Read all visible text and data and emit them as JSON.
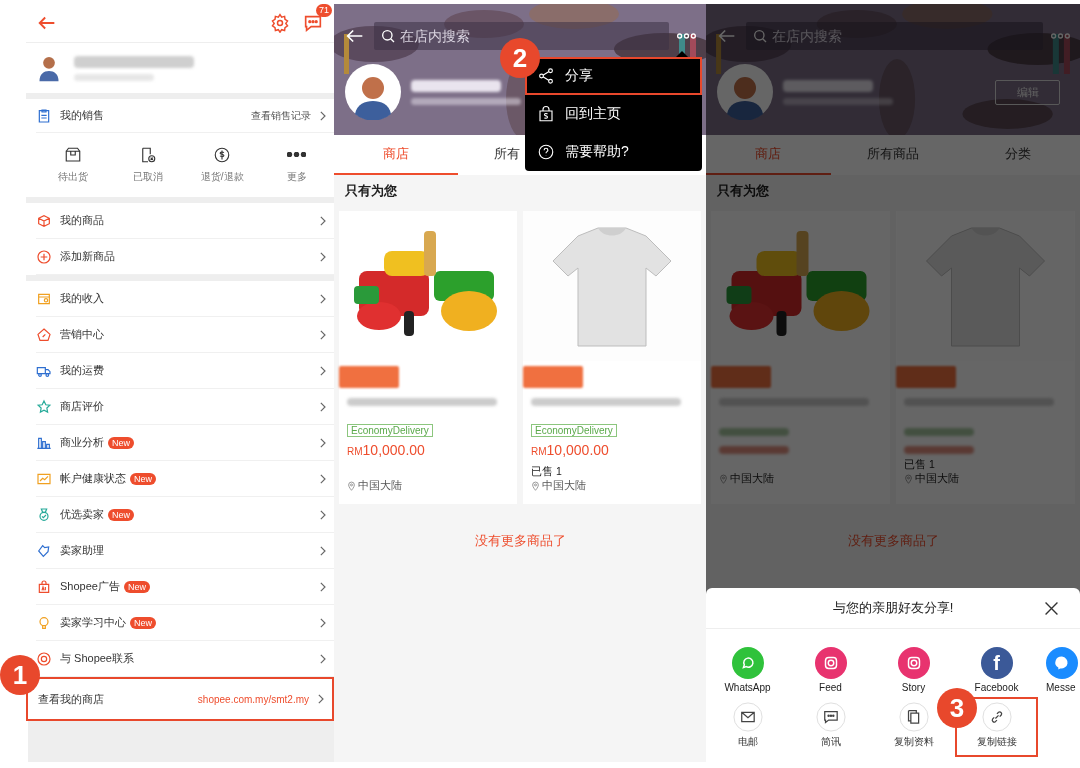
{
  "seller_center": {
    "chat_badge": "71",
    "sales": {
      "title": "我的销售",
      "link": "查看销售记录"
    },
    "shortcuts": [
      {
        "label": "待出货"
      },
      {
        "label": "已取消"
      },
      {
        "label": "退货/退款"
      },
      {
        "label": "更多"
      }
    ],
    "groups": [
      [
        {
          "label": "我的商品"
        },
        {
          "label": "添加新商品"
        }
      ],
      [
        {
          "label": "我的收入"
        },
        {
          "label": "营销中心"
        },
        {
          "label": "我的运费"
        },
        {
          "label": "商店评价"
        },
        {
          "label": "商业分析",
          "badge": "New"
        },
        {
          "label": "帐户健康状态",
          "badge": "New"
        },
        {
          "label": "优选卖家",
          "badge": "New"
        },
        {
          "label": "卖家助理"
        },
        {
          "label": "Shopee广告",
          "badge": "New"
        },
        {
          "label": "卖家学习中心",
          "badge": "New"
        },
        {
          "label": "与 Shopee联系"
        }
      ]
    ],
    "shop_link": {
      "label": "查看我的商店",
      "url": "shopee.com.my/smt2.my",
      "highlighted": true
    }
  },
  "shop_screens": [
    {
      "search_placeholder": "在店内搜索",
      "tabs": [
        {
          "label": "商店",
          "selected": true
        },
        {
          "label": "所有",
          "selected": false
        }
      ],
      "section_title": "只有为您",
      "products": [
        {
          "tag": "EconomyDelivery",
          "currency": "RM",
          "price": "10,000.00",
          "location": "中国大陆"
        },
        {
          "tag": "EconomyDelivery",
          "currency": "RM",
          "price": "10,000.00",
          "sold": "已售 1",
          "location": "中国大陆"
        }
      ],
      "end_note": "没有更多商品了",
      "menu": [
        {
          "label": "分享",
          "highlighted": true
        },
        {
          "label": "回到主页",
          "highlighted": false
        },
        {
          "label": "需要帮助?",
          "highlighted": false
        }
      ]
    },
    {
      "search_placeholder": "在店内搜索",
      "edit_button": "编辑",
      "tabs": [
        {
          "label": "商店",
          "selected": true
        },
        {
          "label": "所有商品",
          "selected": false
        },
        {
          "label": "分类",
          "selected": false
        }
      ],
      "section_title": "只有为您",
      "products": [
        {
          "location": "中国大陆"
        },
        {
          "sold": "已售 1",
          "location": "中国大陆"
        }
      ],
      "end_note": "没有更多商品了",
      "share_sheet": {
        "title": "与您的亲朋好友分享!",
        "apps": [
          {
            "label": "WhatsApp",
            "kind": "whatsapp",
            "color": "#2fc23b"
          },
          {
            "label": "Feed",
            "kind": "instagram",
            "color": "#e8336f"
          },
          {
            "label": "Story",
            "kind": "instagram",
            "color": "#e8336f"
          },
          {
            "label": "Facebook",
            "kind": "facebook",
            "glyph": "f",
            "color": "#3b5998"
          },
          {
            "label": "Messe",
            "kind": "messenger",
            "color": "#1a8cff"
          }
        ],
        "actions": [
          {
            "label": "电邮",
            "kind": "mail",
            "highlighted": false
          },
          {
            "label": "简讯",
            "kind": "sms",
            "highlighted": false
          },
          {
            "label": "复制资料",
            "kind": "copy",
            "highlighted": false
          },
          {
            "label": "复制链接",
            "kind": "link",
            "highlighted": true
          }
        ]
      }
    }
  ],
  "steps": [
    {
      "label": "1"
    },
    {
      "label": "2"
    },
    {
      "label": "3"
    }
  ]
}
